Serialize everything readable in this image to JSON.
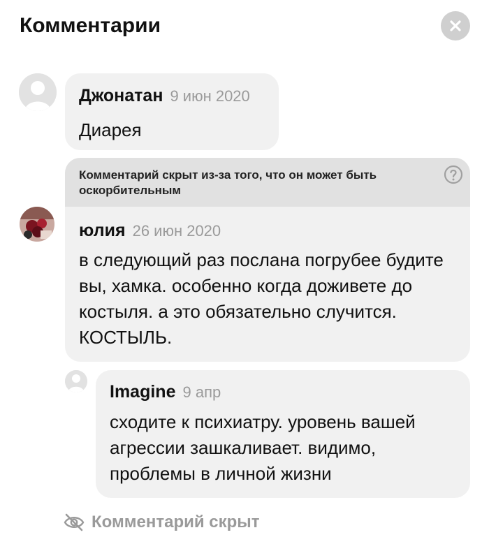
{
  "header": {
    "title": "Комментарии"
  },
  "comments": [
    {
      "author": "Джонатан",
      "date": "9 июн 2020",
      "text": "Диарея"
    },
    {
      "hidden_notice": "Комментарий скрыт из-за того, что он может быть оскорбительным",
      "author": "юлия",
      "date": "26 июн 2020",
      "text": "в следующий раз послана погрубее будите вы, хамка. особенно когда доживете до костыля. а это обязательно случится. КОСТЫЛЬ."
    },
    {
      "author": "Imagine",
      "date": "9 апр",
      "text": "сходите к психиатру. уровень вашей агрессии зашкаливает. видимо, проблемы в личной жизни"
    }
  ],
  "footer": {
    "hidden_label": "Комментарий скрыт"
  },
  "colors": {
    "bubble": "#f1f1f1",
    "banner": "#e1e1e1",
    "muted": "#9a9a9a",
    "close_bg": "#cfcfcf"
  },
  "icons": {
    "close": "close-icon",
    "help": "help-icon",
    "hidden": "eye-off-icon"
  }
}
